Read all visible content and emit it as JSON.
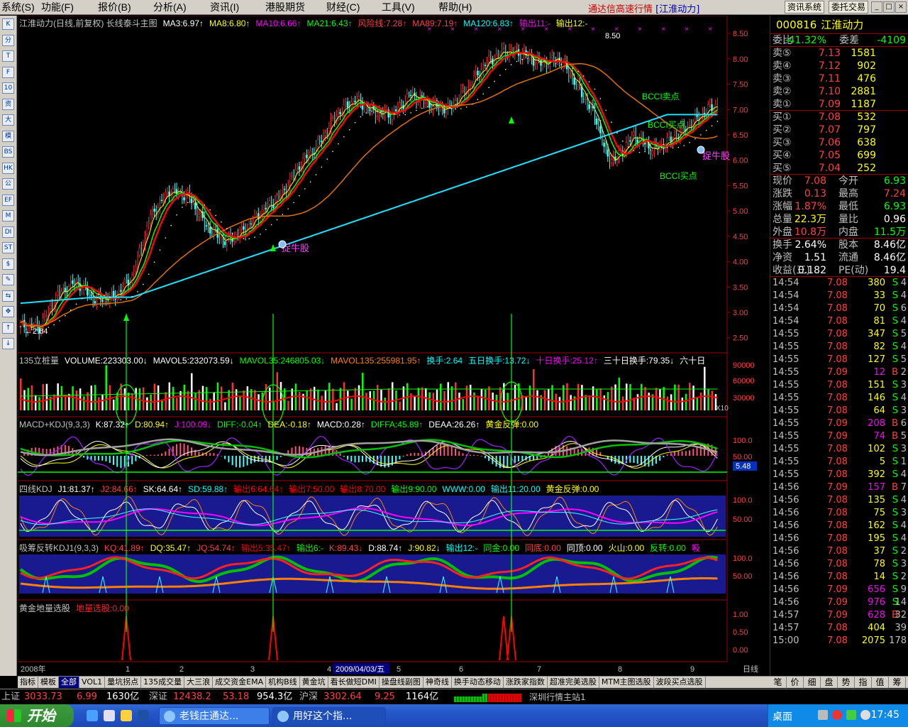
{
  "menu": {
    "items": [
      "系统(S)",
      "功能(F)",
      "报价(B)",
      "分析(A)",
      "资讯(I)",
      "港股期货",
      "财经(C)",
      "工具(V)",
      "帮助(H)"
    ],
    "brand": "通达信高速行情",
    "brand_stock": "[江淮动力]",
    "btn_news": "资讯系统",
    "btn_trade": "委托交易",
    "min": "_",
    "max": "□",
    "close": "×"
  },
  "left_tools": [
    "K",
    "分",
    "T",
    "F",
    "10",
    "资",
    "大",
    "模",
    "BS",
    "HK",
    "公",
    "EF",
    "M",
    "DI",
    "ST",
    "$",
    "✎",
    "⇆",
    "✥",
    "↑",
    "↓"
  ],
  "chart": {
    "main_title": "江淮动力(日线,前复权) 长线泰斗主图",
    "main_items": [
      {
        "t": "MA3:6.97↑",
        "c": "#ffffff"
      },
      {
        "t": "MA8:6.80↑",
        "c": "#ffff00"
      },
      {
        "t": "MA10:6.66↑",
        "c": "#ff00ff"
      },
      {
        "t": "MA21:6.43↑",
        "c": "#00ff00"
      },
      {
        "t": "风险线:7.28↑",
        "c": "#ff4040"
      },
      {
        "t": "MA89:7.19↑",
        "c": "#ff4040"
      },
      {
        "t": "MA120:6.83↑",
        "c": "#00ffff"
      },
      {
        "t": "输出11:-",
        "c": "#ff00ff"
      },
      {
        "t": "输出12:-",
        "c": "#ffff00"
      }
    ],
    "price_axis": [
      "8.50",
      "8.00",
      "7.50",
      "7.00",
      "6.50",
      "6.00",
      "5.50",
      "5.00",
      "4.50",
      "4.00",
      "3.50",
      "3.00",
      "2.50"
    ],
    "annotations": {
      "high": "8.50",
      "low": "2.64",
      "catch1": "捉牛股",
      "catch2": "捉牛股",
      "bottom": "BCCI买点",
      "top": "BCCI卖点"
    },
    "vol_title": "135立桩量",
    "vol_items": [
      {
        "t": "VOLUME:223303.00↓",
        "c": "#ffffff"
      },
      {
        "t": "MAVOL5:232073.59↓",
        "c": "#ffffff"
      },
      {
        "t": "MAVOL35:246805.03↓",
        "c": "#00ff00"
      },
      {
        "t": "MAVOL135:255981.95↑",
        "c": "#ff8000"
      },
      {
        "t": "换手:2.64",
        "c": "#00ffff"
      },
      {
        "t": "五日换手:13.72↓",
        "c": "#00ffff"
      },
      {
        "t": "十日换手:25.12↑",
        "c": "#ff00ff"
      },
      {
        "t": "三十日换手:79.35↓",
        "c": "#ffffff"
      },
      {
        "t": "六十日",
        "c": "#ffffff"
      }
    ],
    "vol_axis": [
      "90000",
      "60000",
      "30000"
    ],
    "vol_unit": "X10",
    "macd_title": "MACD+KDJ(9,3,3)",
    "macd_items": [
      {
        "t": "K:87.32↑",
        "c": "#ffffff"
      },
      {
        "t": "D:80.94↑",
        "c": "#ffff00"
      },
      {
        "t": "J:100.09↓",
        "c": "#ff00ff"
      },
      {
        "t": "DIFF:-0.04↑",
        "c": "#00ff00"
      },
      {
        "t": "DEA:-0.18↑",
        "c": "#ffff00"
      },
      {
        "t": "MACD:0.28↑",
        "c": "#ffffff"
      },
      {
        "t": "DIFFA:45.89↑",
        "c": "#00ff00"
      },
      {
        "t": "DEAA:26.26↑",
        "c": "#ffffff"
      },
      {
        "t": "黄金反弹:0.00",
        "c": "#ffff00"
      }
    ],
    "macd_axis": [
      "100.0",
      "50.00"
    ],
    "macd_label": "5.48",
    "kdj4_title": "四线KDJ",
    "kdj4_items": [
      {
        "t": "J1:81.37↑",
        "c": "#ffffff"
      },
      {
        "t": "J2:84.66↑",
        "c": "#ff4040"
      },
      {
        "t": "SK:64.64↑",
        "c": "#ffffff"
      },
      {
        "t": "SD:59.88↑",
        "c": "#00ffff"
      },
      {
        "t": "输出6:64.64↑",
        "c": "#ff0000"
      },
      {
        "t": "输出7:50.00",
        "c": "#ff0000"
      },
      {
        "t": "输出8:70.00",
        "c": "#ff0000"
      },
      {
        "t": "输出9:90.00",
        "c": "#00ff00"
      },
      {
        "t": "WWW:0.00",
        "c": "#00ffff"
      },
      {
        "t": "输出11:20.00",
        "c": "#00ffff"
      },
      {
        "t": "黄金反弹:0.00",
        "c": "#ffff00"
      }
    ],
    "kdj4_axis": [
      "100.0",
      "50.00"
    ],
    "xcf_title": "吸筹反转KDJ1(9,3,3)",
    "xcf_items": [
      {
        "t": "KQ:41.89↑",
        "c": "#ff4040"
      },
      {
        "t": "DQ:35.47↑",
        "c": "#ffff00"
      },
      {
        "t": "JQ:54.74↑",
        "c": "#ff4040"
      },
      {
        "t": "输出5:35.47↑",
        "c": "#ff0000"
      },
      {
        "t": "输出6:-",
        "c": "#00ff00"
      },
      {
        "t": "K:89.43↓",
        "c": "#ff4040"
      },
      {
        "t": "D:88.74↑",
        "c": "#ffffff"
      },
      {
        "t": "J:90.82↓",
        "c": "#ffff00"
      },
      {
        "t": "输出12:-",
        "c": "#00ffff"
      },
      {
        "t": "同金:0.00",
        "c": "#00ff00"
      },
      {
        "t": "同底:0.00",
        "c": "#ff4040"
      },
      {
        "t": "同顶:0.00",
        "c": "#ffffff"
      },
      {
        "t": "火山:0.00",
        "c": "#ffff00"
      },
      {
        "t": "反转:0.00",
        "c": "#00ff00"
      },
      {
        "t": "吸",
        "c": "#ff00ff"
      }
    ],
    "xcf_axis": [
      "100.0",
      "50.00"
    ],
    "gold_title": "黄金地量选股",
    "gold_item": "地量选股:0.00",
    "gold_axis": [
      "1.00",
      "0.50",
      "0.00"
    ],
    "dates": [
      "2008年",
      "1",
      "2",
      "3",
      "4",
      "2009/04/03/五",
      "5",
      "6",
      "7",
      "8",
      "9"
    ],
    "period": "日线"
  },
  "quote": {
    "code": "000816",
    "name": "江淮动力",
    "ratio": {
      "l": "委比",
      "v": "-41.32%",
      "l2": "委差",
      "v2": "-4109"
    },
    "sell": [
      {
        "l": "卖⑤",
        "p": "7.13",
        "q": "1581"
      },
      {
        "l": "卖④",
        "p": "7.12",
        "q": "902"
      },
      {
        "l": "卖③",
        "p": "7.11",
        "q": "476"
      },
      {
        "l": "卖②",
        "p": "7.10",
        "q": "2881"
      },
      {
        "l": "卖①",
        "p": "7.09",
        "q": "1187"
      }
    ],
    "buy": [
      {
        "l": "买①",
        "p": "7.08",
        "q": "532"
      },
      {
        "l": "买②",
        "p": "7.07",
        "q": "797"
      },
      {
        "l": "买③",
        "p": "7.06",
        "q": "638"
      },
      {
        "l": "买④",
        "p": "7.05",
        "q": "699"
      },
      {
        "l": "买⑤",
        "p": "7.04",
        "q": "252"
      }
    ],
    "stats": [
      {
        "l": "现价",
        "v": "7.08",
        "c": "#ff4040",
        "l2": "今开",
        "v2": "6.93",
        "c2": "#00ff00"
      },
      {
        "l": "涨跌",
        "v": "0.13",
        "c": "#ff4040",
        "l2": "最高",
        "v2": "7.24",
        "c2": "#ff4040"
      },
      {
        "l": "涨幅",
        "v": "1.87%",
        "c": "#ff4040",
        "l2": "最低",
        "v2": "6.93",
        "c2": "#00ff00"
      },
      {
        "l": "总量",
        "v": "22.3万",
        "c": "#ffff00",
        "l2": "量比",
        "v2": "0.96",
        "c2": "#ffffff"
      },
      {
        "l": "外盘",
        "v": "10.8万",
        "c": "#ff4040",
        "l2": "内盘",
        "v2": "11.5万",
        "c2": "#00ff00"
      }
    ],
    "stats2": [
      {
        "l": "换手",
        "v": "2.64%",
        "c": "#ffffff",
        "l2": "股本",
        "v2": "8.46亿",
        "c2": "#ffffff"
      },
      {
        "l": "净资",
        "v": "1.51",
        "c": "#ffffff",
        "l2": "流通",
        "v2": "8.46亿",
        "c2": "#ffffff"
      },
      {
        "l": "收益(三)",
        "v": "0.182",
        "c": "#ffffff",
        "l2": "PE(动)",
        "v2": "19.4",
        "c2": "#ffffff"
      }
    ],
    "ticks": [
      [
        "14:54",
        "7.08",
        "380",
        "S",
        "4"
      ],
      [
        "14:54",
        "7.08",
        "33",
        "S",
        "4"
      ],
      [
        "14:54",
        "7.08",
        "70",
        "S",
        "6"
      ],
      [
        "14:54",
        "7.08",
        "81",
        "S",
        "4"
      ],
      [
        "14:55",
        "7.08",
        "347",
        "S",
        "5"
      ],
      [
        "14:55",
        "7.08",
        "82",
        "S",
        "4"
      ],
      [
        "14:55",
        "7.08",
        "127",
        "S",
        "5"
      ],
      [
        "14:55",
        "7.09",
        "12",
        "B",
        "2"
      ],
      [
        "14:55",
        "7.08",
        "151",
        "S",
        "3"
      ],
      [
        "14:55",
        "7.08",
        "146",
        "S",
        "4"
      ],
      [
        "14:55",
        "7.08",
        "64",
        "S",
        "3"
      ],
      [
        "14:55",
        "7.09",
        "208",
        "B",
        "6"
      ],
      [
        "14:55",
        "7.09",
        "74",
        "B",
        "5"
      ],
      [
        "14:55",
        "7.08",
        "102",
        "S",
        "3"
      ],
      [
        "14:55",
        "7.08",
        "5",
        "S",
        "1"
      ],
      [
        "14:55",
        "7.08",
        "392",
        "S",
        "4"
      ],
      [
        "14:56",
        "7.09",
        "157",
        "B",
        "7"
      ],
      [
        "14:56",
        "7.08",
        "135",
        "S",
        "4"
      ],
      [
        "14:56",
        "7.08",
        "75",
        "S",
        "3"
      ],
      [
        "14:56",
        "7.08",
        "162",
        "S",
        "4"
      ],
      [
        "14:56",
        "7.08",
        "195",
        "S",
        "4"
      ],
      [
        "14:56",
        "7.08",
        "37",
        "S",
        "2"
      ],
      [
        "14:56",
        "7.08",
        "78",
        "S",
        "3"
      ],
      [
        "14:56",
        "7.08",
        "14",
        "S",
        "2"
      ],
      [
        "14:56",
        "7.09",
        "656",
        "S",
        "9"
      ],
      [
        "14:56",
        "7.09",
        "976",
        "S",
        "14"
      ],
      [
        "14:57",
        "7.09",
        "628",
        "B",
        "32"
      ],
      [
        "14:57",
        "7.08",
        "404",
        "",
        "39"
      ],
      [
        "15:00",
        "7.08",
        "2075",
        "",
        "178"
      ]
    ]
  },
  "tabs": [
    "指标",
    "模板",
    "全部",
    "VOL1",
    "量坑拐点",
    "135成交量",
    "大三浪",
    "成交资金EMA",
    "机构B线",
    "黄金坑",
    "看长做短DMI",
    "操盘线副图",
    "神奇线",
    "换手动态移动",
    "涨跌家指数",
    "超准完美选股",
    "MTM主图选股",
    "波段买点选股"
  ],
  "rtabs": [
    "笔",
    "价",
    "细",
    "盘",
    "势",
    "指",
    "值",
    "筹"
  ],
  "status": {
    "sh_l": "上证",
    "sh_v": "3033.73",
    "sh_c": "6.99",
    "sh_a": "1630亿",
    "sz_l": "深证",
    "sz_v": "12438.2",
    "sz_c": "53.18",
    "sz_a": "954.3亿",
    "hs_l": "沪深",
    "hs_v": "3302.64",
    "hs_c": "9.25",
    "hs_a": "1164亿",
    "server": "深圳行情主站1"
  },
  "taskbar": {
    "start": "开始",
    "task1": "老钱庄通达...",
    "task2": "用好这个指...",
    "desktop": "桌面",
    "clock": "17:45"
  },
  "colors": {
    "up": "#ff4040",
    "down": "#00ffff",
    "ma_red": "#ff0000",
    "ma_orange": "#e07000",
    "ma_cyan": "#20e0ff",
    "signal": "#00ff00"
  }
}
